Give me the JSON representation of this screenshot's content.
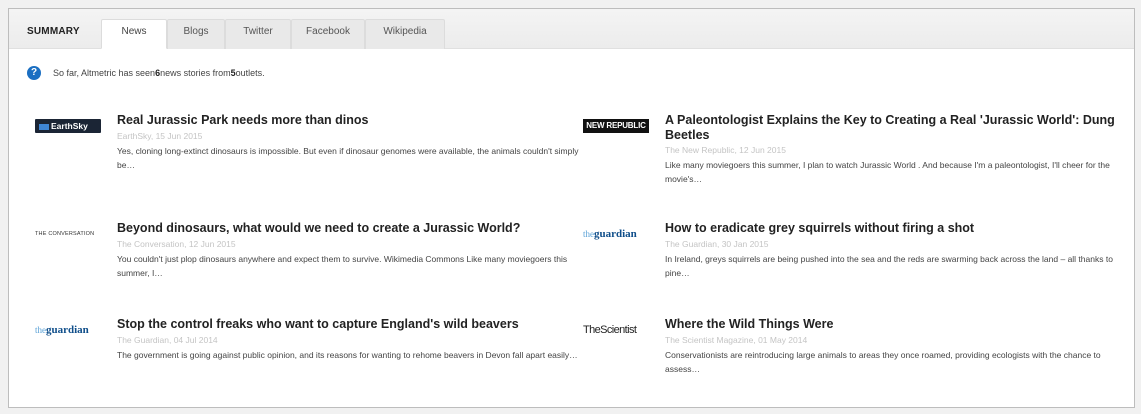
{
  "tabs": {
    "summary": "SUMMARY",
    "news": "News",
    "blogs": "Blogs",
    "twitter": "Twitter",
    "facebook": "Facebook",
    "wikipedia": "Wikipedia",
    "active": "News"
  },
  "info": {
    "icon": "help-icon",
    "prefix": "So far, Altmetric has seen ",
    "count": "6",
    "middle": " news stories from ",
    "outlets": "5",
    "suffix": " outlets."
  },
  "stories": [
    {
      "logo": "EarthSky",
      "title": "Real Jurassic Park needs more than dinos",
      "meta": "EarthSky, 15 Jun 2015",
      "snippet": "Yes, cloning long-extinct dinosaurs is impossible. But even if dinosaur genomes were available, the animals couldn't simply be…"
    },
    {
      "logo": "NEW REPUBLIC",
      "title": "A Paleontologist Explains the Key to Creating a Real 'Jurassic World': Dung Beetles",
      "meta": "The New Republic, 12 Jun 2015",
      "snippet": "Like many moviegoers this summer, I plan to watch Jurassic World . And because I'm a paleontologist, I'll cheer for the movie's…"
    },
    {
      "logo": "THE CONVERSATION",
      "title": "Beyond dinosaurs, what would we need to create a Jurassic World?",
      "meta": "The Conversation, 12 Jun 2015",
      "snippet": "You couldn't just plop dinosaurs anywhere and expect them to survive. Wikimedia Commons Like many moviegoers this summer, I…"
    },
    {
      "logo": "guardian",
      "title": "How to eradicate grey squirrels without firing a shot",
      "meta": "The Guardian, 30 Jan 2015",
      "snippet": "In Ireland, greys squirrels are being pushed into the sea and the reds are swarming back across the land – all thanks to pine…"
    },
    {
      "logo": "guardian",
      "title": "Stop the control freaks who want to capture England's wild beavers",
      "meta": "The Guardian, 04 Jul 2014",
      "snippet": "The government is going against public opinion, and its reasons for wanting to rehome beavers in Devon fall apart easily…"
    },
    {
      "logo": "TheScientist",
      "title": "Where the Wild Things Were",
      "meta": "The Scientist Magazine, 01 May 2014",
      "snippet": "Conservationists are reintroducing large animals to areas they once roamed, providing ecologists with the chance to assess…"
    }
  ]
}
